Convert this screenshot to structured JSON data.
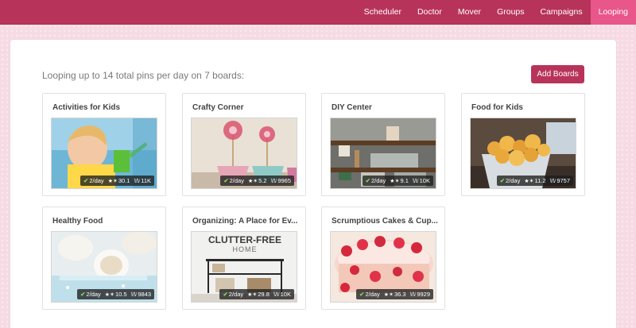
{
  "nav": {
    "items": [
      {
        "label": "Scheduler",
        "active": false
      },
      {
        "label": "Doctor",
        "active": false
      },
      {
        "label": "Mover",
        "active": false
      },
      {
        "label": "Groups",
        "active": false
      },
      {
        "label": "Campaigns",
        "active": false
      },
      {
        "label": "Looping",
        "active": true
      }
    ]
  },
  "summary": "Looping up to 14 total pins per day on 7 boards:",
  "add_boards_label": "Add Boards",
  "boards": [
    {
      "title": "Activities for Kids",
      "rate": "2/day",
      "stat_a": "30.1",
      "stat_b": "11K"
    },
    {
      "title": "Crafty Corner",
      "rate": "2/day",
      "stat_a": "5.2",
      "stat_b": "9965"
    },
    {
      "title": "DIY Center",
      "rate": "2/day",
      "stat_a": "9.1",
      "stat_b": "10K"
    },
    {
      "title": "Food for Kids",
      "rate": "2/day",
      "stat_a": "11.2",
      "stat_b": "9757"
    },
    {
      "title": "Healthy Food",
      "rate": "2/day",
      "stat_a": "10.5",
      "stat_b": "9843"
    },
    {
      "title": "Organizing: A Place for Ev...",
      "rate": "2/day",
      "stat_a": "29.8",
      "stat_b": "10K",
      "image_text": [
        "CLUTTER-FREE",
        "HOME"
      ]
    },
    {
      "title": "Scrumptious Cakes & Cup...",
      "rate": "2/day",
      "stat_a": "36.3",
      "stat_b": "9929"
    }
  ],
  "icons": {
    "check": "check-icon",
    "repin": "repin-icon",
    "followers": "followers-icon"
  },
  "colors": {
    "brand": "#b8335a",
    "active_tab": "#e8568a",
    "check": "#7ed957"
  }
}
